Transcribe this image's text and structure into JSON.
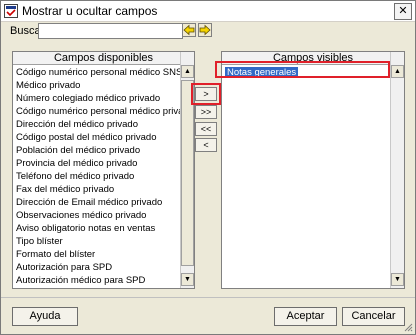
{
  "window": {
    "title": "Mostrar u ocultar campos",
    "close_glyph": "✕"
  },
  "search": {
    "label": "Buscar",
    "value": "",
    "icons": [
      "arrow-left-icon",
      "arrow-right-icon"
    ]
  },
  "available": {
    "header": "Campos disponibles",
    "items": [
      "Código numérico personal médico SNS",
      "Médico privado",
      "Número colegiado médico privado",
      "Código numérico personal médico privado",
      "Dirección del médico privado",
      "Código postal del médico privado",
      "Población del médico privado",
      "Provincia del médico privado",
      "Teléfono del médico privado",
      "Fax del médico privado",
      "Dirección de Email médico privado",
      "Observaciones médico privado",
      "Aviso obligatorio notas en ventas",
      "Tipo blíster",
      "Formato del blíster",
      "Autorización para SPD",
      "Autorización médico para SPD"
    ]
  },
  "visible": {
    "header": "Campos visibles",
    "items": [
      "Notas generales"
    ]
  },
  "move_buttons": {
    "add": ">",
    "add_all": ">>",
    "remove_all": "<<",
    "remove": "<"
  },
  "footer": {
    "help_label": "Ayuda",
    "accept_label": "Aceptar",
    "cancel_label": "Cancelar"
  },
  "colors": {
    "selection": "#3169c6",
    "highlight": "#e0202a",
    "dialog_bg": "#ece9d8"
  }
}
